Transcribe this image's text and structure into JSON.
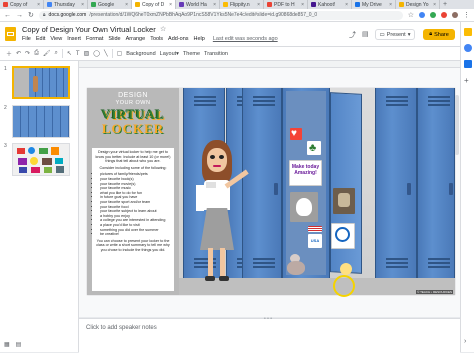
{
  "browser": {
    "tabs": [
      {
        "label": "Copy of",
        "color": "#ea4335",
        "active": false
      },
      {
        "label": "Thursday",
        "color": "#4285f4",
        "active": false
      },
      {
        "label": "Google",
        "color": "#34a853",
        "active": false
      },
      {
        "label": "Copy of D",
        "color": "#f4b400",
        "active": true
      },
      {
        "label": "World Ha",
        "color": "#673ab7",
        "active": false
      },
      {
        "label": "Flippity.n",
        "color": "#fbbc04",
        "active": false
      },
      {
        "label": "PDF to H",
        "color": "#ea4335",
        "active": false
      },
      {
        "label": "Kahoot!",
        "color": "#46178f",
        "active": false
      },
      {
        "label": "My Drive",
        "color": "#1a73e8",
        "active": false
      },
      {
        "label": "Design Yo",
        "color": "#f4b400",
        "active": false
      }
    ],
    "url_host": "docs.google.com",
    "url_path": "/presentation/d/1WQ6heT0xmZNPbBhAqAo9P1ncS58V1Yks5Ne7e4c/edit#slide=id.g90868de857_0_0"
  },
  "app": {
    "doc_title": "Copy of Design Your Own Virtual Locker",
    "menu": [
      "File",
      "Edit",
      "View",
      "Insert",
      "Format",
      "Slide",
      "Arrange",
      "Tools",
      "Add-ons",
      "Help"
    ],
    "last_edit": "Last edit was seconds ago",
    "present_label": "Present",
    "share_label": "Share"
  },
  "toolbar": {
    "background_label": "Background",
    "layout_label": "Layout",
    "theme_label": "Theme",
    "transition_label": "Transition"
  },
  "filmstrip": {
    "slides": [
      {
        "number": "1"
      },
      {
        "number": "2"
      },
      {
        "number": "3"
      }
    ]
  },
  "slide": {
    "title_line1": "DESIGN",
    "title_line2": "YOUR OWN",
    "title_virtual": "VIRTUAL",
    "title_locker": "LOCKER",
    "intro": "Design your virtual locker to help me get to know you better. Include at least 10 (or more!) things that tell about who you are.",
    "consider": "Consider including some of the following:",
    "items": [
      "pictures of family/friends/pets",
      "your favorite book(s)",
      "your favorite movie(s)",
      "your favorite music",
      "what you like to do for fun",
      "in future goal you have",
      "your favorite sport and/or team",
      "your favorite food",
      "your favorite subject to learn about",
      "a hobby you enjoy",
      "a college you are interested in attending",
      "a place you'd like to visit",
      "something you did over the summer",
      "be creative!"
    ],
    "closing": "You can choose to present your locker to the class or write a short summary to tell me why you chose to include the things you did.",
    "sticker_text": "Make today Amazing!",
    "sticker_usa": "USA",
    "credit": "© TEACH • RESOURCES"
  },
  "notes": {
    "placeholder": "Click to add speaker notes"
  }
}
